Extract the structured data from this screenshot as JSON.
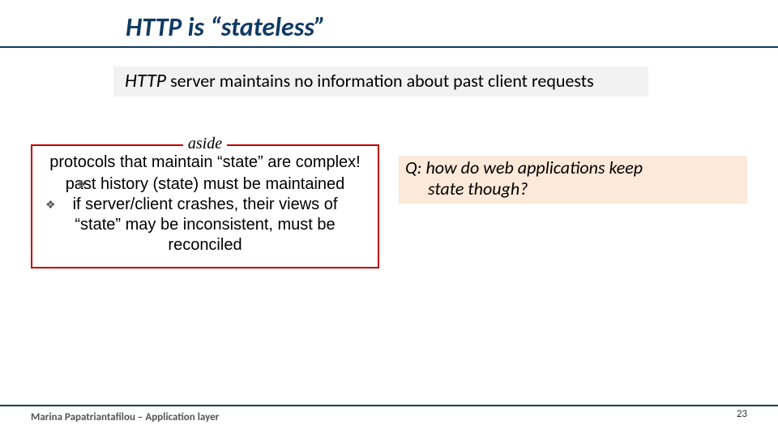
{
  "title_prefix": "HTTP is ",
  "title_quoted": "“stateless”",
  "statement": {
    "http": "HTTP",
    "rest": " server maintains no information about past client requests"
  },
  "aside": {
    "label": "aside",
    "lead": "protocols that maintain “state” are complex!",
    "items": [
      "past history (state) must be maintained",
      "if server/client crashes, their views of “state” may be inconsistent, must be reconciled"
    ]
  },
  "question_line1": "Q: how do web applications keep",
  "question_line2": "state though?",
  "footer": "Marina Papatriantafilou –  Application layer",
  "page": "23",
  "bullet_glyph": "❖"
}
